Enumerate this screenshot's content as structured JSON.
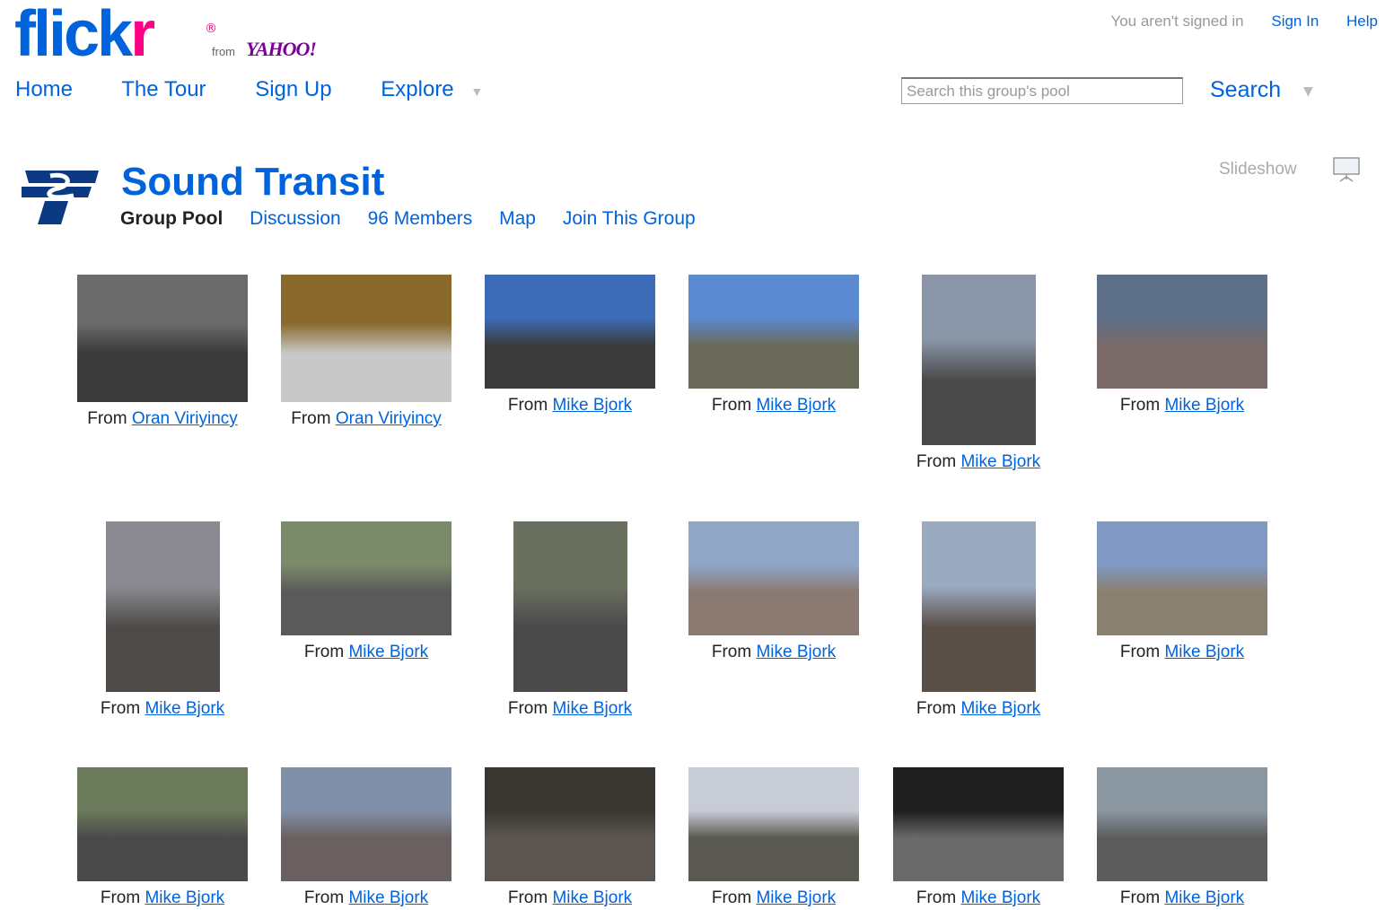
{
  "header": {
    "logo_text": "flickr",
    "logo_from": "from",
    "logo_yahoo": "YAHOO!",
    "signed_in_note": "You aren't signed in",
    "sign_in": "Sign In",
    "help": "Help"
  },
  "nav": {
    "home": "Home",
    "tour": "The Tour",
    "signup": "Sign Up",
    "explore": "Explore"
  },
  "search": {
    "placeholder": "Search this group's pool",
    "button": "Search"
  },
  "group": {
    "title": "Sound Transit",
    "tabs": {
      "pool": "Group Pool",
      "discussion": "Discussion",
      "members": "96 Members",
      "map": "Map",
      "join": "Join This Group"
    },
    "slideshow": "Slideshow"
  },
  "caption_prefix": "From",
  "photos": [
    {
      "owner": "Oran Viriyincy",
      "sky": "#6b6b6b",
      "ground": "#3a3a3a"
    },
    {
      "owner": "Oran Viriyincy",
      "sky": "#8a6a2c",
      "ground": "#c8c8c8"
    },
    {
      "owner": "Mike Bjork",
      "sky": "#3c6cb8",
      "ground": "#3b3b3b"
    },
    {
      "owner": "Mike Bjork",
      "sky": "#5b8ad0",
      "ground": "#6a6a5a"
    },
    {
      "owner": "Mike Bjork",
      "sky": "#8a96a8",
      "ground": "#4a4a4a"
    },
    {
      "owner": "Mike Bjork",
      "sky": "#5e6f88",
      "ground": "#7a6a6a"
    },
    {
      "owner": "Mike Bjork",
      "sky": "#8a8a90",
      "ground": "#4e4a48"
    },
    {
      "owner": "Mike Bjork",
      "sky": "#7a8a6a",
      "ground": "#5a5a5a"
    },
    {
      "owner": "Mike Bjork",
      "sky": "#6a7060",
      "ground": "#4a4a4a"
    },
    {
      "owner": "Mike Bjork",
      "sky": "#8fa6c6",
      "ground": "#8a7a72"
    },
    {
      "owner": "Mike Bjork",
      "sky": "#9aaac0",
      "ground": "#5a5048"
    },
    {
      "owner": "Mike Bjork",
      "sky": "#7f99c2",
      "ground": "#8a8070"
    },
    {
      "owner": "Mike Bjork",
      "sky": "#6a7a5a",
      "ground": "#4a4a4a"
    },
    {
      "owner": "Mike Bjork",
      "sky": "#8090a8",
      "ground": "#6a6060"
    },
    {
      "owner": "Mike Bjork",
      "sky": "#3a3632",
      "ground": "#5a5550"
    },
    {
      "owner": "Mike Bjork",
      "sky": "#c8ccd6",
      "ground": "#5a5a52"
    },
    {
      "owner": "Mike Bjork",
      "sky": "#1e1e1e",
      "ground": "#6a6a6a"
    },
    {
      "owner": "Mike Bjork",
      "sky": "#8a96a0",
      "ground": "#5c5c5c"
    }
  ],
  "colors": {
    "link": "#0063dc",
    "pink": "#ff0084",
    "yahoo": "#7b0099"
  }
}
